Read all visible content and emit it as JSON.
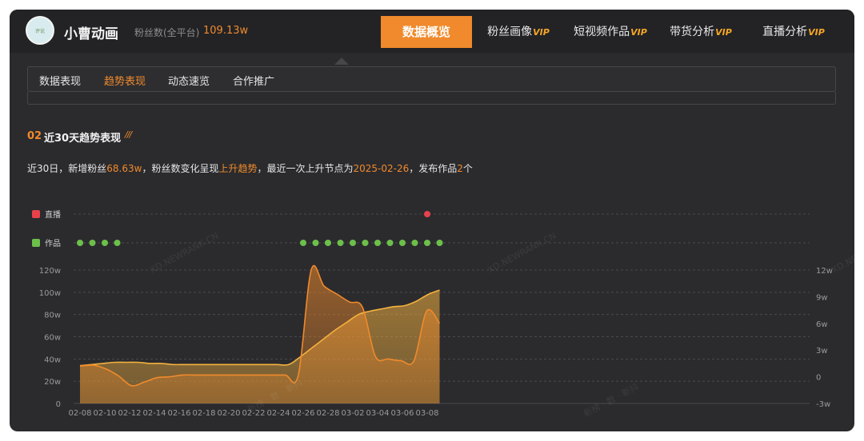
{
  "header": {
    "avatar_text": "评论",
    "account_name": "小曹动画",
    "fans_label": "粉丝数(全平台)",
    "fans_value": "109.13w",
    "tabs": [
      {
        "label": "数据概览",
        "vip": ""
      },
      {
        "label": "粉丝画像",
        "vip": "VIP"
      },
      {
        "label": "短视频作品",
        "vip": "VIP"
      },
      {
        "label": "带货分析",
        "vip": "VIP"
      },
      {
        "label": "直播分析",
        "vip": "VIP"
      }
    ]
  },
  "subtabs": [
    "数据表现",
    "趋势表现",
    "动态速览",
    "合作推广"
  ],
  "section": {
    "number": "02",
    "title": "近30天趋势表现",
    "summary": {
      "p1": "近30日，新增粉丝",
      "new_fans": "68.63w",
      "p2": "，粉丝数变化呈现",
      "trend": "上升趋势",
      "p3": "，最近一次上升节点为",
      "date": "2025-02-26",
      "p4": "，发布作品",
      "works": "2",
      "p5": "个"
    }
  },
  "chart_data": {
    "type": "area",
    "colors": {
      "total": "#f5b23f",
      "increment": "#f08a2c",
      "live": "#e8414b",
      "work": "#6cc04a"
    },
    "event_rows": [
      {
        "name": "直播",
        "icon": "live-icon",
        "dates": [
          "03-08"
        ]
      },
      {
        "name": "作品",
        "icon": "work-icon",
        "dates": [
          "02-08",
          "02-09",
          "02-10",
          "02-11",
          "02-26",
          "02-27",
          "02-28",
          "03-01",
          "03-02",
          "03-03",
          "03-04",
          "03-05",
          "03-06",
          "03-07",
          "03-08",
          "03-09"
        ]
      }
    ],
    "x_ticks": [
      "02-08",
      "02-10",
      "02-12",
      "02-14",
      "02-16",
      "02-18",
      "02-20",
      "02-22",
      "02-24",
      "02-26",
      "02-28",
      "03-02",
      "03-04",
      "03-06",
      "03-08"
    ],
    "y_left": {
      "ticks": [
        "0",
        "20w",
        "40w",
        "60w",
        "80w",
        "100w",
        "120w"
      ],
      "range": [
        0,
        120
      ]
    },
    "y_right": {
      "ticks": [
        "-3w",
        "0",
        "3w",
        "6w",
        "9w",
        "12w"
      ],
      "range": [
        -3,
        12
      ]
    },
    "x_dates": [
      "02-08",
      "02-09",
      "02-10",
      "02-11",
      "02-12",
      "02-13",
      "02-14",
      "02-15",
      "02-16",
      "02-17",
      "02-18",
      "02-19",
      "02-20",
      "02-21",
      "02-22",
      "02-23",
      "02-24",
      "02-25",
      "02-26",
      "02-27",
      "02-28",
      "03-01",
      "03-02",
      "03-03",
      "03-04",
      "03-05",
      "03-06",
      "03-07",
      "03-08",
      "03-09"
    ],
    "series": [
      {
        "axis": "left",
        "values": [
          34,
          35,
          36,
          37,
          37,
          37,
          36,
          36,
          35,
          35,
          35,
          35,
          35,
          35,
          35,
          35,
          35,
          35,
          35,
          42,
          50,
          58,
          66,
          73,
          80,
          83,
          85,
          87,
          88,
          92,
          98,
          102
        ]
      },
      {
        "axis": "right",
        "values": [
          1.2,
          1.3,
          0.9,
          0.1,
          -1.0,
          -0.6,
          -0.1,
          0.0,
          0.2,
          0.2,
          0.2,
          0.2,
          0.2,
          0.2,
          0.2,
          0.2,
          0.2,
          0.2,
          12.0,
          10.2,
          9.3,
          8.4,
          7.8,
          2.3,
          2.0,
          1.8,
          1.8,
          7.4,
          6.0
        ]
      }
    ]
  },
  "watermarks": [
    "XD.NEWRANK.CN",
    "XD.NEWRANK.CN",
    "XD.NEWRANK.CN",
    "新榜 · 数 · 新抖",
    "新榜 · 数 · 新抖"
  ]
}
